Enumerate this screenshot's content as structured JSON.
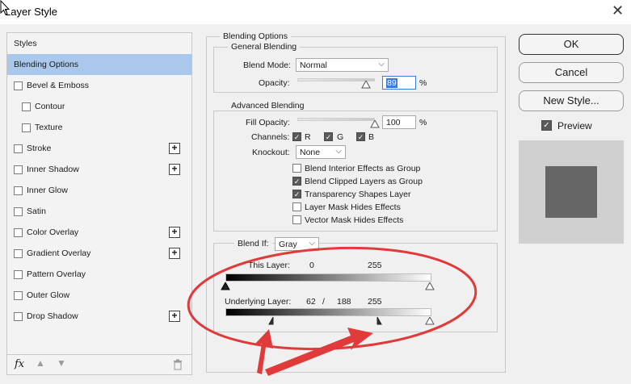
{
  "window": {
    "title": "Layer Style"
  },
  "styles_panel": {
    "header": "Styles",
    "items": [
      {
        "label": "Blending Options",
        "checkbox": false,
        "plus": false,
        "indent": false,
        "selected": true
      },
      {
        "label": "Bevel & Emboss",
        "checkbox": true,
        "plus": false,
        "indent": false
      },
      {
        "label": "Contour",
        "checkbox": true,
        "plus": false,
        "indent": true
      },
      {
        "label": "Texture",
        "checkbox": true,
        "plus": false,
        "indent": true
      },
      {
        "label": "Stroke",
        "checkbox": true,
        "plus": true,
        "indent": false
      },
      {
        "label": "Inner Shadow",
        "checkbox": true,
        "plus": true,
        "indent": false
      },
      {
        "label": "Inner Glow",
        "checkbox": true,
        "plus": false,
        "indent": false
      },
      {
        "label": "Satin",
        "checkbox": true,
        "plus": false,
        "indent": false
      },
      {
        "label": "Color Overlay",
        "checkbox": true,
        "plus": true,
        "indent": false
      },
      {
        "label": "Gradient Overlay",
        "checkbox": true,
        "plus": true,
        "indent": false
      },
      {
        "label": "Pattern Overlay",
        "checkbox": true,
        "plus": false,
        "indent": false
      },
      {
        "label": "Outer Glow",
        "checkbox": true,
        "plus": false,
        "indent": false
      },
      {
        "label": "Drop Shadow",
        "checkbox": true,
        "plus": true,
        "indent": false
      }
    ],
    "fx_label": "fx"
  },
  "blending": {
    "title": "Blending Options",
    "general": {
      "title": "General Blending",
      "blend_mode_label": "Blend Mode:",
      "blend_mode_value": "Normal",
      "opacity_label": "Opacity:",
      "opacity_value": "89",
      "opacity_unit": "%",
      "opacity_level": 0.89
    },
    "advanced": {
      "title": "Advanced Blending",
      "fill_opacity_label": "Fill Opacity:",
      "fill_opacity_value": "100",
      "fill_unit": "%",
      "fill_level": 1.0,
      "channels_label": "Channels:",
      "channels": [
        "R",
        "G",
        "B"
      ],
      "knockout_label": "Knockout:",
      "knockout_value": "None",
      "options": [
        {
          "label": "Blend Interior Effects as Group",
          "checked": false
        },
        {
          "label": "Blend Clipped Layers as Group",
          "checked": true
        },
        {
          "label": "Transparency Shapes Layer",
          "checked": true
        },
        {
          "label": "Layer Mask Hides Effects",
          "checked": false
        },
        {
          "label": "Vector Mask Hides Effects",
          "checked": false
        }
      ]
    },
    "blend_if": {
      "label": "Blend If:",
      "value": "Gray",
      "this_layer_label": "This Layer:",
      "this_low": "0",
      "this_high": "255",
      "underlying_label": "Underlying Layer:",
      "under_low": "62",
      "under_sep": "/",
      "under_mid": "188",
      "under_high": "255"
    }
  },
  "buttons": {
    "ok": "OK",
    "cancel": "Cancel",
    "new_style": "New Style...",
    "preview": "Preview"
  },
  "colors": {
    "annotation": "#e03a3a",
    "selected_row": "#a9c8ec",
    "preview_swatch": "#666666"
  }
}
